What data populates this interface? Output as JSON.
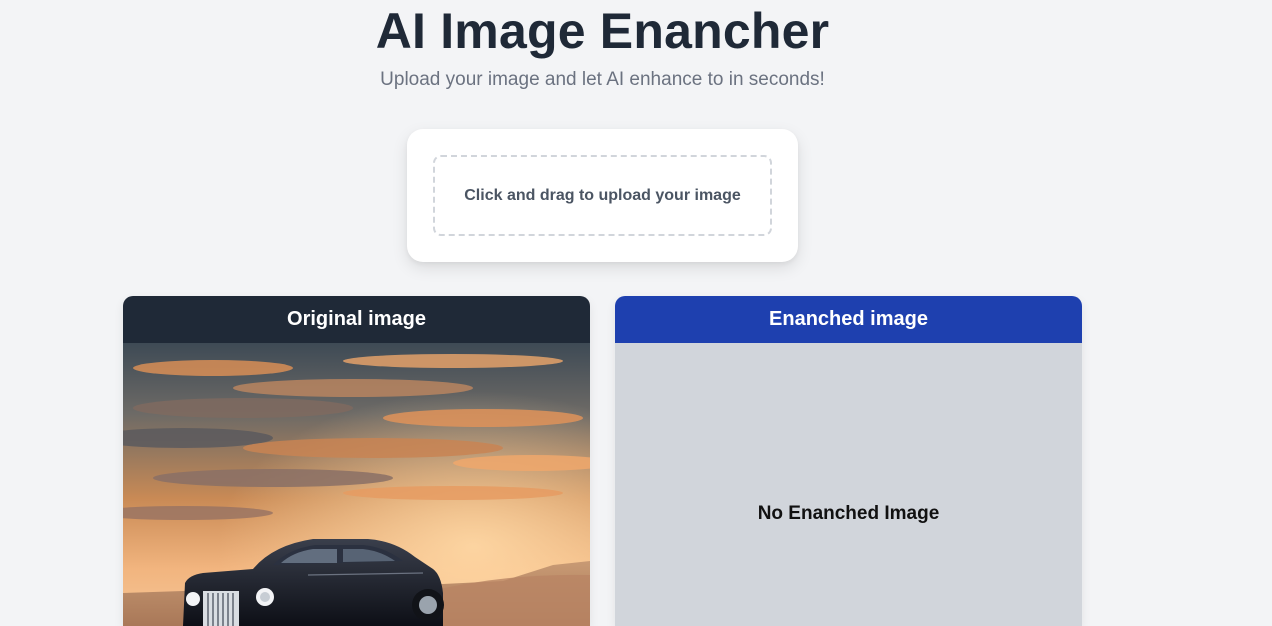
{
  "header": {
    "title": "AI Image Enancher",
    "subtitle": "Upload your image and let AI enhance to in seconds!"
  },
  "upload": {
    "label": "Click and drag to upload your image"
  },
  "panels": {
    "original": {
      "title": "Original image",
      "image_subject": "luxury-car-at-desert-sunset"
    },
    "enhanced": {
      "title": "Enanched image",
      "empty_text": "No Enanched Image"
    }
  },
  "colors": {
    "background": "#f3f4f6",
    "title_text": "#1f2937",
    "original_header": "#1f2937",
    "enhanced_header": "#1e40af",
    "enhanced_placeholder": "#d1d5db"
  }
}
